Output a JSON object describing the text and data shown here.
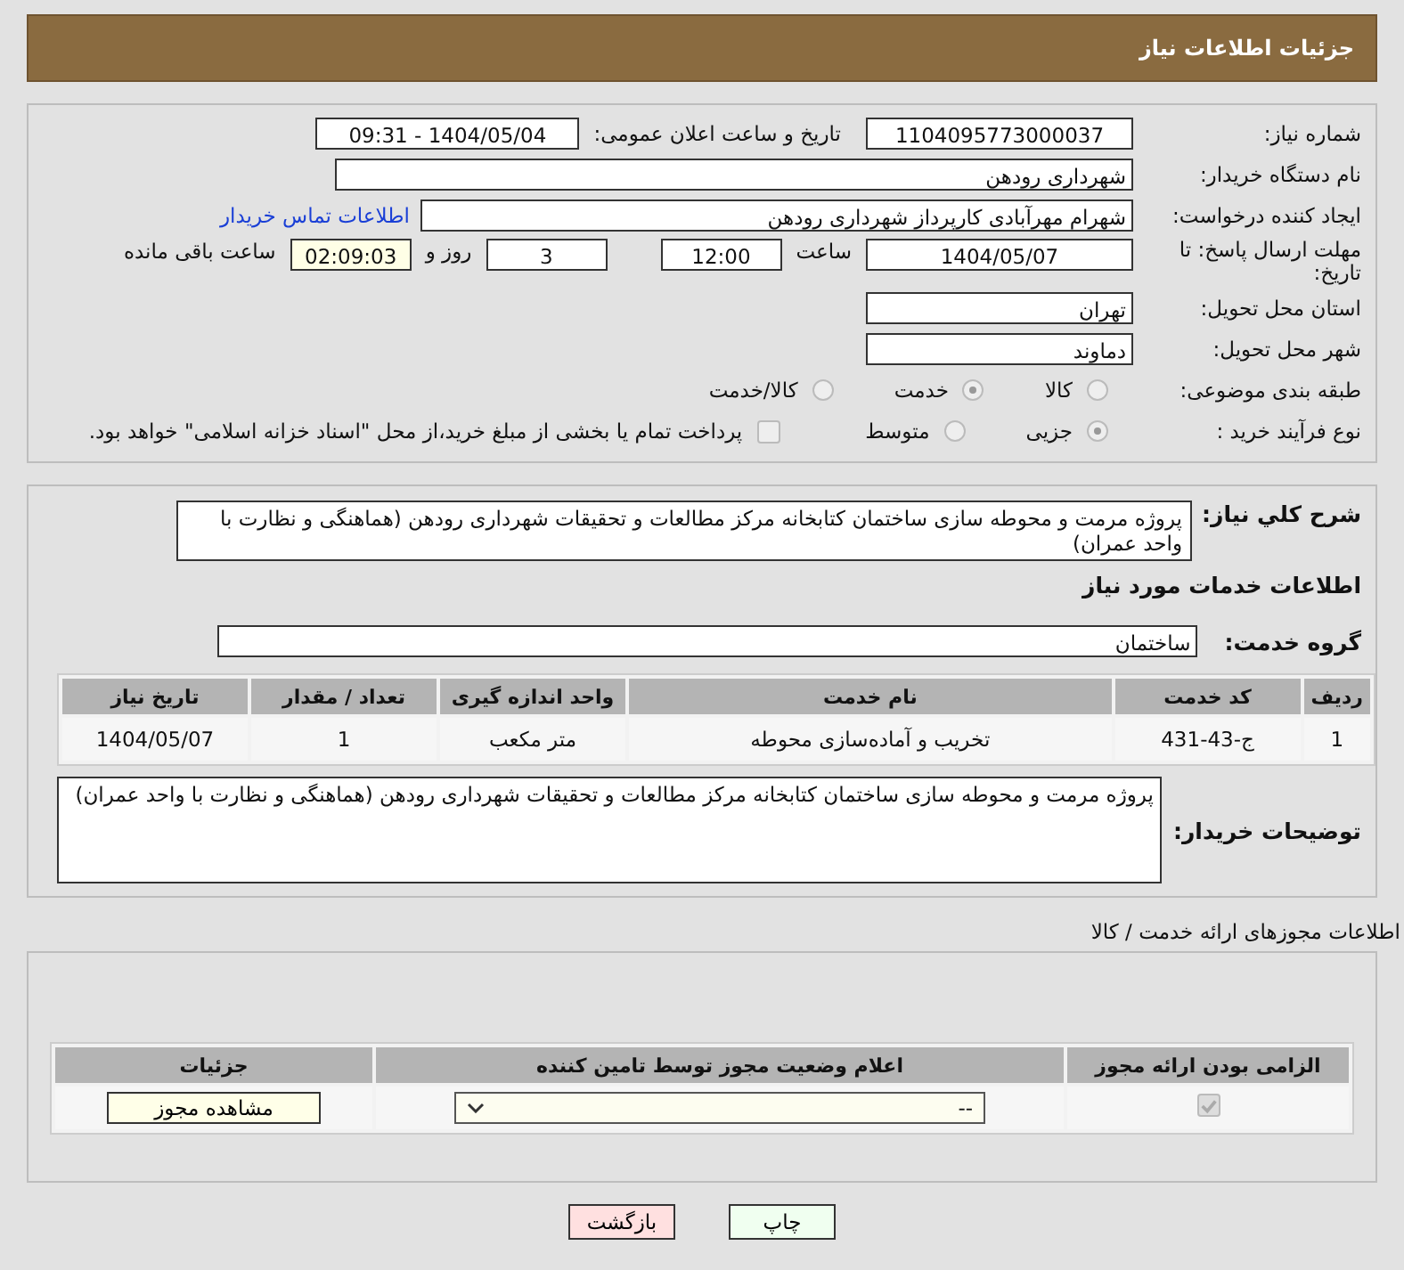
{
  "header": {
    "title": "جزئیات اطلاعات نیاز"
  },
  "need_number": {
    "label": "شماره نیاز:",
    "value": "1104095773000037"
  },
  "announce": {
    "label": "تاریخ و ساعت اعلان عمومی:",
    "value": "1404/05/04 - 09:31"
  },
  "buyer_org": {
    "label": "نام دستگاه خریدار:",
    "value": "شهرداری رودهن"
  },
  "requester": {
    "label": "ایجاد کننده درخواست:",
    "value": "شهرام مهرآبادی کارپرداز شهرداری رودهن",
    "contact_link": "اطلاعات تماس خریدار"
  },
  "deadline": {
    "label": "مهلت ارسال پاسخ: تا تاریخ:",
    "date": "1404/05/07",
    "time_label": "ساعت",
    "time": "12:00",
    "days": "3",
    "days_label": "روز و",
    "remaining": "02:09:03",
    "remaining_label": "ساعت باقی مانده"
  },
  "province": {
    "label": "استان محل تحویل:",
    "value": "تهران"
  },
  "city": {
    "label": "شهر محل تحویل:",
    "value": "دماوند"
  },
  "category": {
    "label": "طبقه بندی موضوعی:",
    "options": [
      {
        "label": "کالا",
        "selected": false
      },
      {
        "label": "خدمت",
        "selected": true
      },
      {
        "label": "کالا/خدمت",
        "selected": false
      }
    ]
  },
  "purchase_type": {
    "label": "نوع فرآیند خرید :",
    "options": [
      {
        "label": "جزیی",
        "selected": true
      },
      {
        "label": "متوسط",
        "selected": false
      }
    ],
    "treasury": {
      "checked": false,
      "text": "پرداخت تمام یا بخشی از مبلغ خرید،از محل \"اسناد خزانه اسلامی\" خواهد بود."
    }
  },
  "summary": {
    "label": "شرح کلي نياز:",
    "text": "پروژه مرمت و محوطه سازی ساختمان کتابخانه مرکز مطالعات و تحقیقات شهرداری رودهن (هماهنگی و نظارت با واحد عمران)"
  },
  "services_heading": "اطلاعات خدمات مورد نیاز",
  "service_group": {
    "label": "گروه خدمت:",
    "value": "ساختمان"
  },
  "services_table": {
    "columns": [
      "ردیف",
      "کد خدمت",
      "نام خدمت",
      "واحد اندازه گیری",
      "تعداد / مقدار",
      "تاریخ نیاز"
    ],
    "rows": [
      [
        "1",
        "ج-43-431",
        "تخریب و آماده‌سازی محوطه",
        "متر مکعب",
        "1",
        "1404/05/07"
      ]
    ]
  },
  "buyer_notes": {
    "label": "توضیحات خریدار:",
    "text": "پروژه مرمت و محوطه سازی ساختمان کتابخانه مرکز مطالعات و تحقیقات شهرداری رودهن (هماهنگی و نظارت با واحد عمران)"
  },
  "licenses_heading": "اطلاعات مجوزهای ارائه خدمت / کالا",
  "licenses_table": {
    "columns": [
      "الزامی بودن ارائه مجوز",
      "اعلام وضعیت مجوز توسط تامین کننده",
      "جزئیات"
    ],
    "rows": [
      {
        "required": true,
        "status": "--",
        "details_button": "مشاهده مجوز"
      }
    ]
  },
  "buttons": [
    {
      "kind": "print",
      "label": "چاپ"
    },
    {
      "kind": "back",
      "label": "بازگشت"
    }
  ]
}
